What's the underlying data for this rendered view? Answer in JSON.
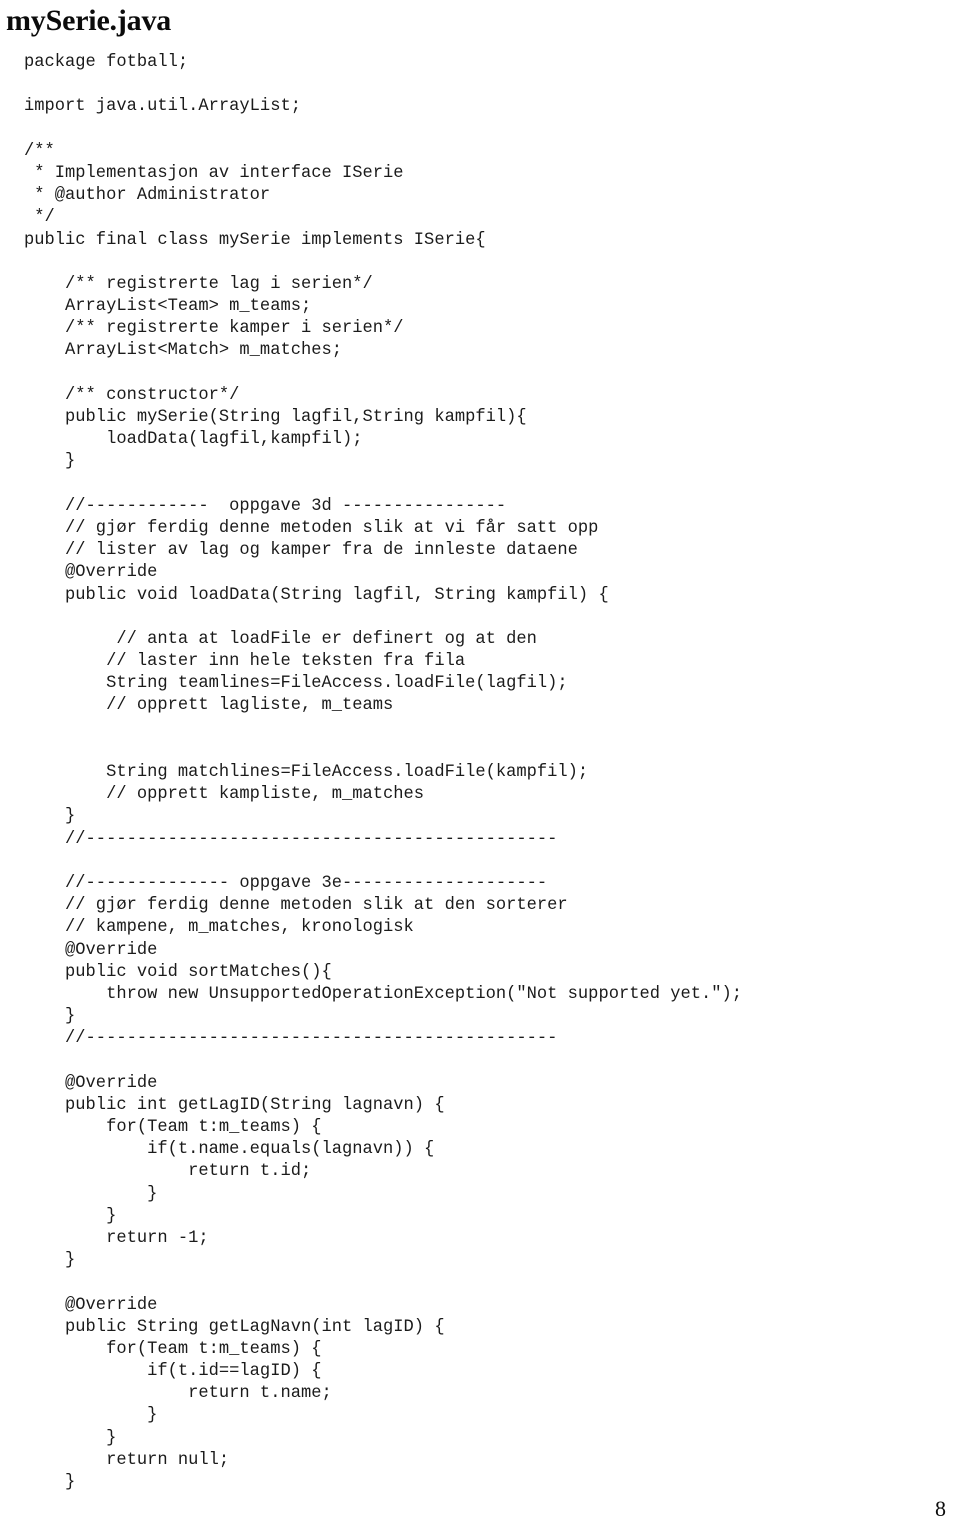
{
  "document": {
    "title": "mySerie.java",
    "page_number": "8",
    "language": "java",
    "code_lines": [
      "package fotball;",
      "",
      "import java.util.ArrayList;",
      "",
      "/**",
      " * Implementasjon av interface ISerie",
      " * @author Administrator",
      " */",
      "public final class mySerie implements ISerie{",
      "",
      "    /** registrerte lag i serien*/",
      "    ArrayList<Team> m_teams;",
      "    /** registrerte kamper i serien*/",
      "    ArrayList<Match> m_matches;",
      "",
      "    /** constructor*/",
      "    public mySerie(String lagfil,String kampfil){",
      "        loadData(lagfil,kampfil);",
      "    }",
      "",
      "    //------------  oppgave 3d ----------------",
      "    // gjør ferdig denne metoden slik at vi får satt opp",
      "    // lister av lag og kamper fra de innleste dataene",
      "    @Override",
      "    public void loadData(String lagfil, String kampfil) {",
      "",
      "         // anta at loadFile er definert og at den",
      "        // laster inn hele teksten fra fila",
      "        String teamlines=FileAccess.loadFile(lagfil);",
      "        // opprett lagliste, m_teams",
      "",
      "",
      "        String matchlines=FileAccess.loadFile(kampfil);",
      "        // opprett kampliste, m_matches",
      "    }",
      "    //----------------------------------------------",
      "",
      "    //-------------- oppgave 3e--------------------",
      "    // gjør ferdig denne metoden slik at den sorterer",
      "    // kampene, m_matches, kronologisk",
      "    @Override",
      "    public void sortMatches(){",
      "        throw new UnsupportedOperationException(\"Not supported yet.\");",
      "    }",
      "    //----------------------------------------------",
      "",
      "    @Override",
      "    public int getLagID(String lagnavn) {",
      "        for(Team t:m_teams) {",
      "            if(t.name.equals(lagnavn)) {",
      "                return t.id;",
      "            }",
      "        }",
      "        return -1;",
      "    }",
      "",
      "    @Override",
      "    public String getLagNavn(int lagID) {",
      "        for(Team t:m_teams) {",
      "            if(t.id==lagID) {",
      "                return t.name;",
      "            }",
      "        }",
      "        return null;",
      "    }"
    ]
  }
}
